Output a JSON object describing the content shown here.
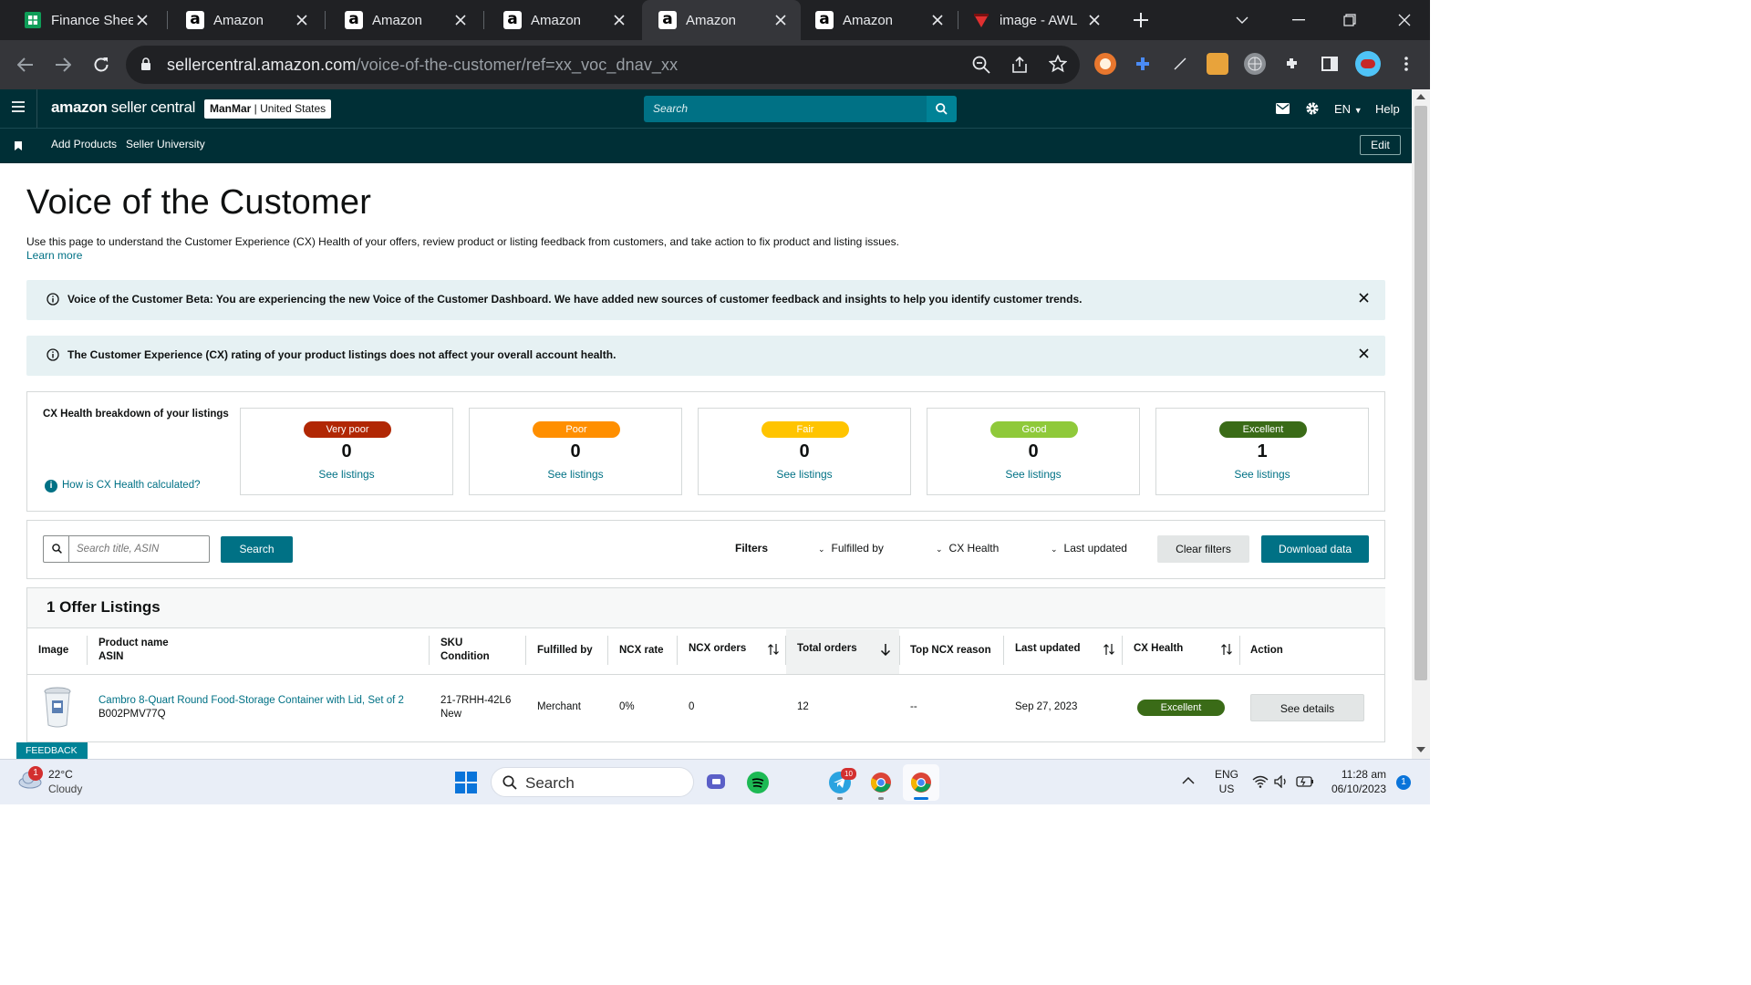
{
  "browser": {
    "tabs": [
      {
        "title": "Finance Sheet",
        "favicon": "sheets-icon"
      },
      {
        "title": "Amazon",
        "favicon": "amazon-icon"
      },
      {
        "title": "Amazon",
        "favicon": "amazon-icon"
      },
      {
        "title": "Amazon",
        "favicon": "amazon-icon"
      },
      {
        "title": "Amazon",
        "favicon": "amazon-icon",
        "active": true
      },
      {
        "title": "Amazon",
        "favicon": "amazon-icon"
      },
      {
        "title": "image - AWL",
        "favicon": "awl-icon"
      }
    ],
    "url_host": "sellercentral.amazon.com",
    "url_path": "/voice-of-the-customer/ref=xx_voc_dnav_xx"
  },
  "header": {
    "logo_brand": "amazon",
    "logo_product": " seller central",
    "account_name": "ManMar",
    "account_region": " | United States",
    "search_placeholder": "Search",
    "language": "EN",
    "help": "Help"
  },
  "nav": {
    "links": [
      "Add Products",
      "Seller University"
    ],
    "edit": "Edit"
  },
  "page": {
    "title": "Voice of the Customer",
    "intro": "Use this page to understand the Customer Experience (CX) Health of your offers, review product or listing feedback from customers, and take action to fix product and listing issues.",
    "learn_more": "Learn more"
  },
  "banners": [
    "Voice of the Customer Beta: You are experiencing the new Voice of the Customer Dashboard. We have added new sources of customer feedback and insights to help you identify customer trends.",
    "The Customer Experience (CX) rating of your product listings does not affect your overall account health."
  ],
  "breakdown": {
    "title": "CX Health breakdown of your listings",
    "how_link": "How is CX Health calculated?",
    "buckets": [
      {
        "label": "Very poor",
        "count": "0",
        "link": "See listings",
        "color": "#b12704"
      },
      {
        "label": "Poor",
        "count": "0",
        "link": "See listings",
        "color": "#ff8f00"
      },
      {
        "label": "Fair",
        "count": "0",
        "link": "See listings",
        "color": "#ffc400"
      },
      {
        "label": "Good",
        "count": "0",
        "link": "See listings",
        "color": "#8fc93a"
      },
      {
        "label": "Excellent",
        "count": "1",
        "link": "See listings",
        "color": "#3a6b17"
      }
    ]
  },
  "filters": {
    "search_placeholder": "Search title, ASIN",
    "search_button": "Search",
    "filters_label": "Filters",
    "fulfilled_by": "Fulfilled by",
    "cx_health": "CX Health",
    "last_updated": "Last updated",
    "clear": "Clear filters",
    "download": "Download data"
  },
  "table": {
    "title": "1 Offer Listings",
    "columns": {
      "image": "Image",
      "product_name": "Product name",
      "asin": "ASIN",
      "sku": "SKU",
      "condition": "Condition",
      "fulfilled_by": "Fulfilled by",
      "ncx_rate": "NCX rate",
      "ncx_orders": "NCX orders",
      "total_orders": "Total orders",
      "top_ncx_reason": "Top NCX reason",
      "last_updated": "Last updated",
      "cx_health": "CX Health",
      "action": "Action"
    },
    "rows": [
      {
        "product_name": "Cambro 8-Quart Round Food-Storage Container with Lid, Set of 2",
        "asin": "B002PMV77Q",
        "sku": "21-7RHH-42L6",
        "condition": "New",
        "fulfilled_by": "Merchant",
        "ncx_rate": "0%",
        "ncx_orders": "0",
        "total_orders": "12",
        "top_ncx_reason": "--",
        "last_updated": "Sep 27, 2023",
        "cx_health": "Excellent",
        "action": "See details"
      }
    ]
  },
  "feedback": "FEEDBACK",
  "taskbar": {
    "weather_temp": "22°C",
    "weather_desc": "Cloudy",
    "weather_badge": "1",
    "search": "Search",
    "telegram_badge": "10",
    "lang": "ENG",
    "region": "US",
    "time": "11:28 am",
    "date": "06/10/2023",
    "notif": "1"
  }
}
